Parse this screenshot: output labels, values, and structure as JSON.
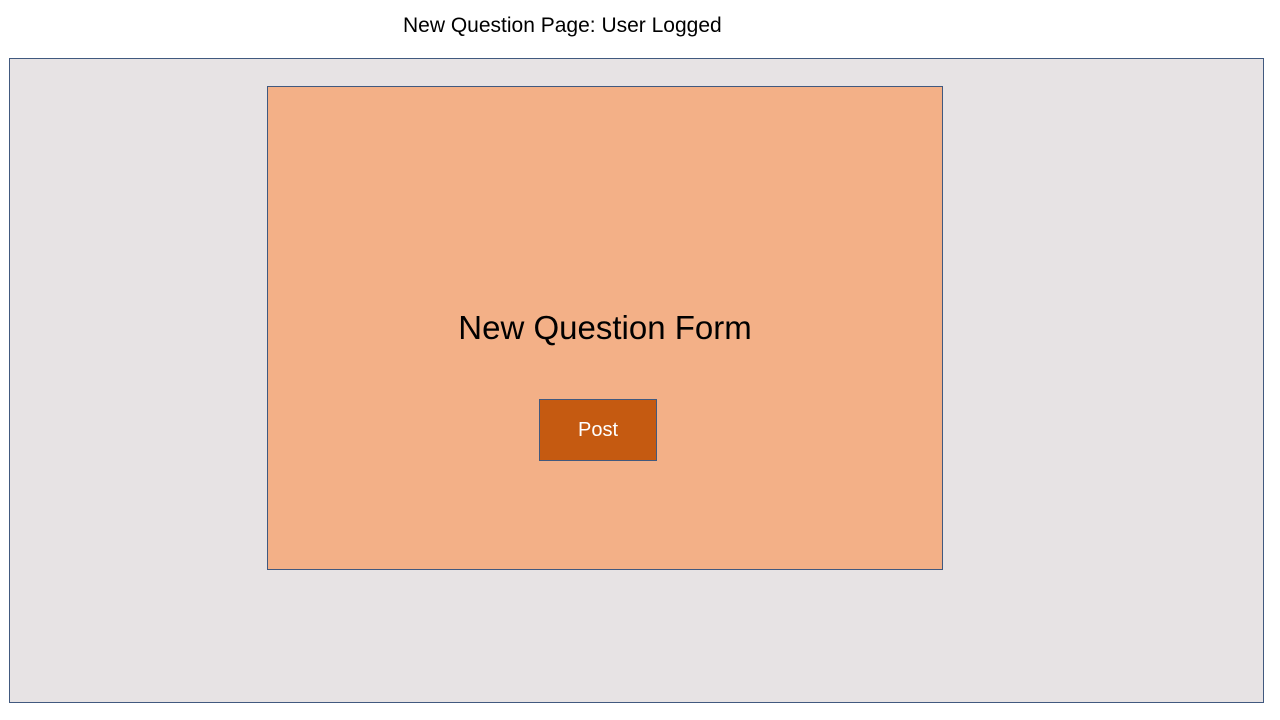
{
  "page": {
    "title": "New Question Page: User Logged"
  },
  "form": {
    "title": "New Question Form",
    "post_label": "Post"
  },
  "colors": {
    "page_background": "#e7e3e4",
    "form_background": "#f3b087",
    "button_background": "#c55a11",
    "border": "#41597f"
  }
}
